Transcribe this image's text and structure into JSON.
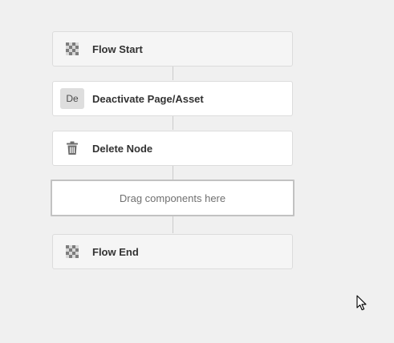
{
  "workflow": {
    "steps": [
      {
        "label": "Flow Start",
        "icon": "checkerboard-icon",
        "kind": "flow-start"
      },
      {
        "label": "Deactivate Page/Asset",
        "icon_text": "De",
        "icon": "deactivate-badge-icon",
        "kind": "process"
      },
      {
        "label": "Delete Node",
        "icon": "trash-icon",
        "kind": "process"
      },
      {
        "label": "Flow End",
        "icon": "checkerboard-icon",
        "kind": "flow-end"
      }
    ],
    "dropzone": {
      "hint": "Drag components here"
    }
  },
  "colors": {
    "background": "#f0f0f0",
    "card": "#ffffff",
    "card_border": "#dcdcdc",
    "connector": "#cbcbcb",
    "dropzone_border": "#c2c2c2",
    "label_text": "#323232",
    "hint_text": "#707070"
  }
}
